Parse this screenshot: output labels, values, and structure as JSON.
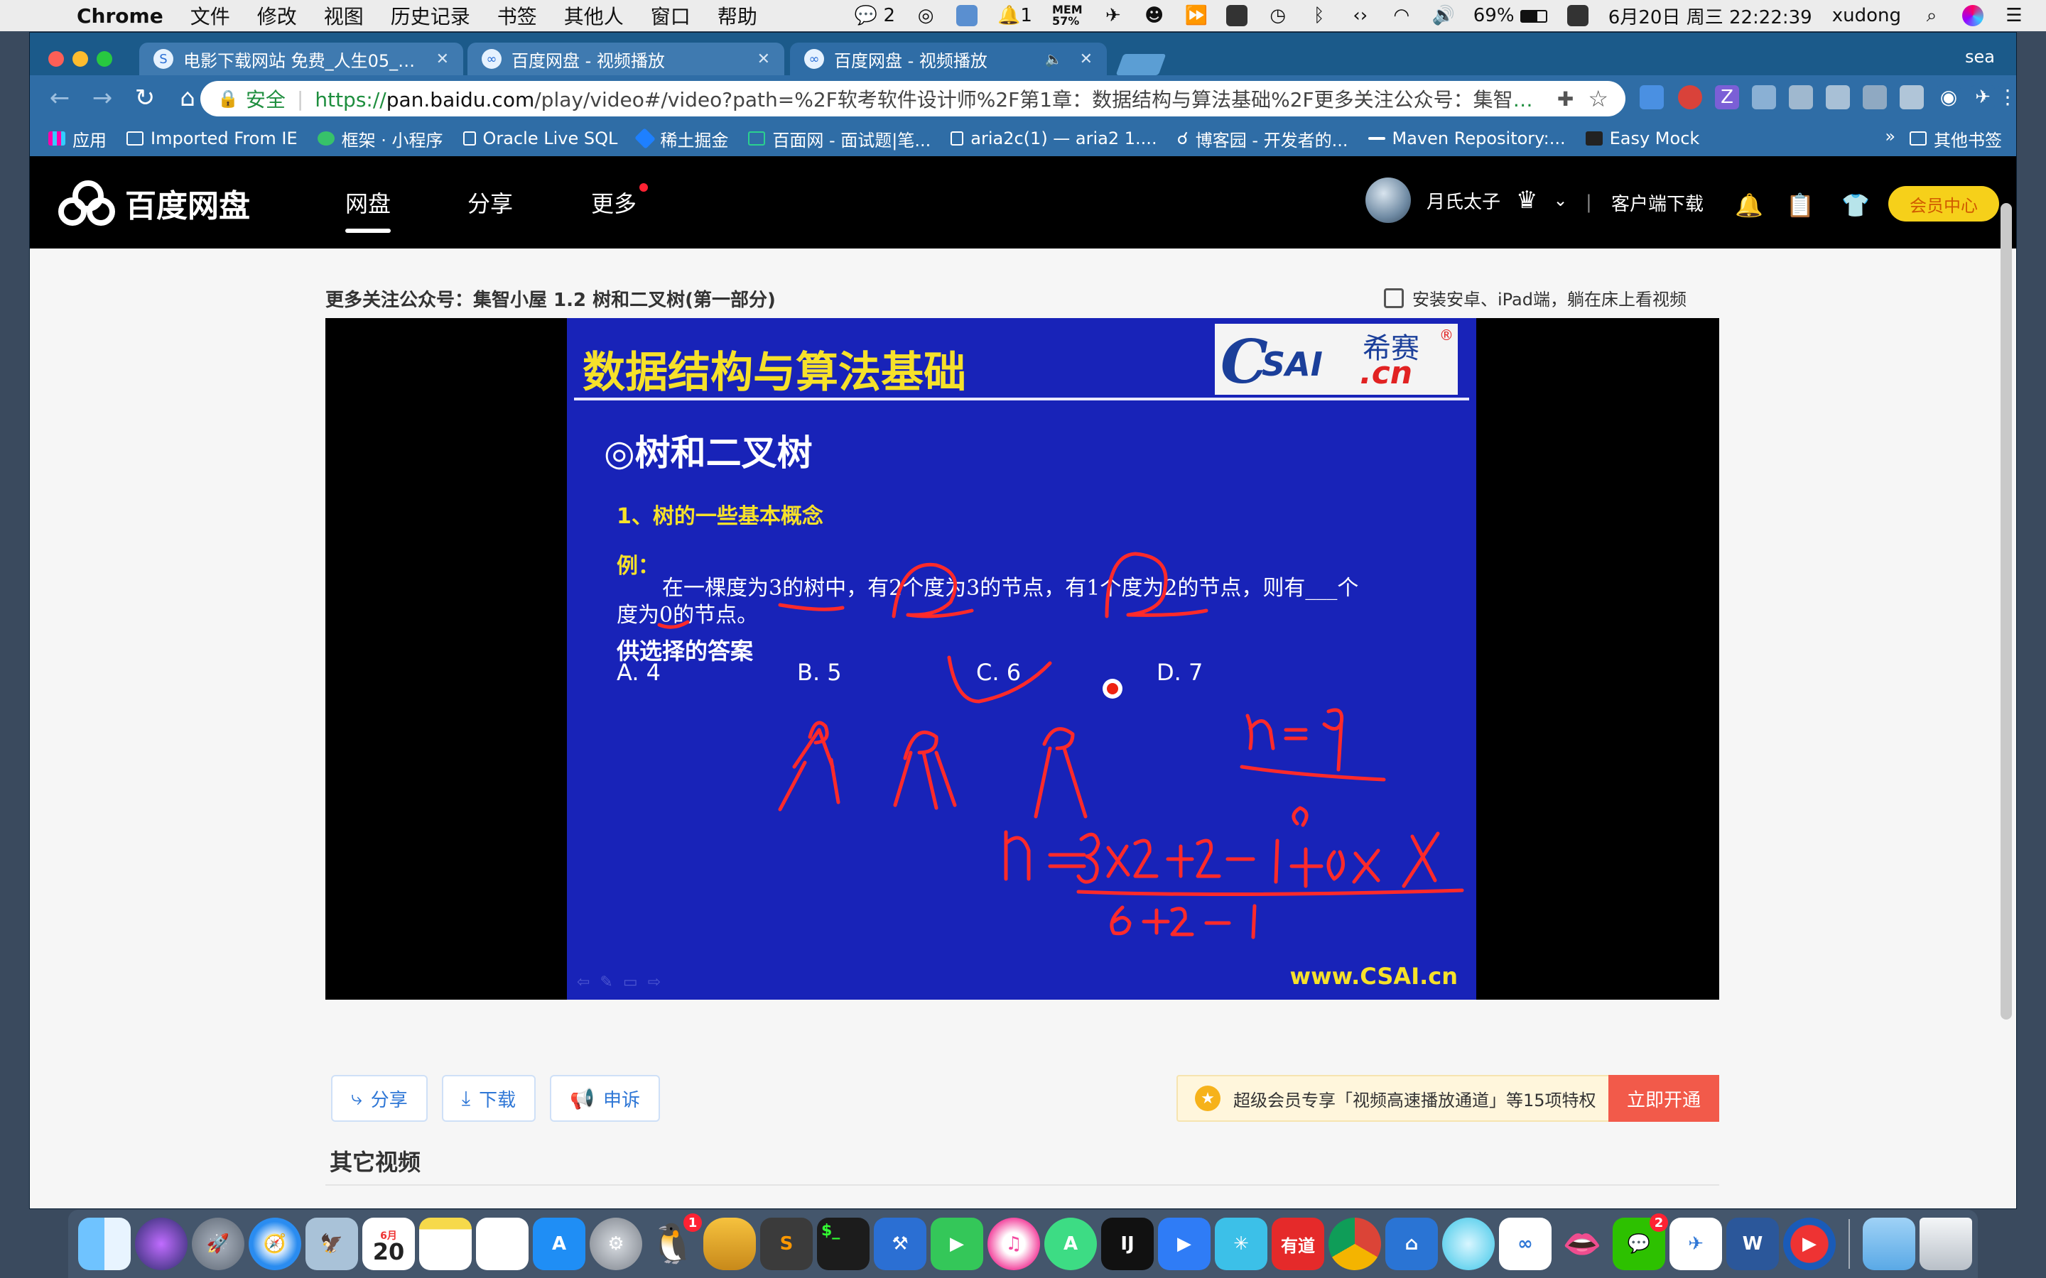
{
  "menubar": {
    "app": "Chrome",
    "menus": [
      "文件",
      "修改",
      "视图",
      "历史记录",
      "书签",
      "其他人",
      "窗口",
      "帮助"
    ],
    "wechat_count": "2",
    "notification_count": "1",
    "mem_label": "MEM",
    "mem_value": "57%",
    "battery": "69%",
    "datetime": "6月20日 周三 22:22:39",
    "user": "xudong"
  },
  "browser": {
    "profile": "sea",
    "tabs": [
      {
        "title": "电影下载网站 免费_人生05_电影",
        "active": false
      },
      {
        "title": "百度网盘 - 视频播放",
        "active": false
      },
      {
        "title": "百度网盘 - 视频播放",
        "active": true
      }
    ],
    "security_label": "安全",
    "url_scheme": "https://",
    "url_host": "pan.baidu.com",
    "url_path": "/play/video#/video?path=%2F软考软件设计师%2F第1章：数据结构与算法基础%2F更多关注公众号：集智小屋%20...",
    "bookmarks": [
      "应用",
      "Imported From IE",
      "框架 · 小程序",
      "Oracle Live SQL",
      "稀土掘金",
      "百面网 - 面试题|笔...",
      "aria2c(1) — aria2 1....",
      "博客园 - 开发者的...",
      "Maven Repository:...",
      "Easy Mock"
    ],
    "bookmarks_more": "»",
    "other_bookmarks": "其他书签"
  },
  "baidu": {
    "logo_text": "百度网盘",
    "nav": [
      "网盘",
      "分享",
      "更多"
    ],
    "username": "月氏太子",
    "client_download": "客户端下载",
    "vip_center": "会员中心",
    "divider": "|"
  },
  "page": {
    "video_title": "更多关注公众号：集智小屋 1.2 树和二叉树(第一部分)",
    "install_tip": "安装安卓、iPad端，躺在床上看视频",
    "actions": [
      {
        "label": "分享",
        "icon": "share-icon"
      },
      {
        "label": "下载",
        "icon": "download-icon"
      },
      {
        "label": "申诉",
        "icon": "megaphone-icon"
      }
    ],
    "promo_text": "超级会员专享「视频高速播放通道」等15项特权",
    "promo_button": "立即开通",
    "other_videos": "其它视频"
  },
  "slide": {
    "title": "数据结构与算法基础",
    "logo_c": "C",
    "logo_sai": "SAI",
    "logo_cn": ".cn",
    "logo_cn_chars": "希赛",
    "logo_reg": "®",
    "heading": "◎树和二叉树",
    "point1": "1、树的一些基本概念",
    "example_label": "例：",
    "question_line1": "在一棵度为3的树中，有2个度为3的节点，有1个度为2的节点，则有___个",
    "question_line2": "度为0的节点。",
    "options_label": "供选择的答案",
    "options": [
      "A. 4",
      "B. 5",
      "C. 6",
      "D. 7"
    ],
    "footer_url": "www.CSAI.cn",
    "controls": "⇦✎▭⇨",
    "answer_selected": "C"
  },
  "dock": {
    "qq_badge": "1",
    "wechat_badge": "2",
    "calendar_month": "6月",
    "calendar_day": "20",
    "youdao_label": "有道",
    "word_label": "W",
    "idea_label": "IJ"
  },
  "colors": {
    "tab_strip": "#1b5a8a",
    "toolbar": "#2f6da6",
    "slide_bg": "#1823b8",
    "slide_yellow": "#f6e12a",
    "ink_red": "#ff2a2a",
    "vip_yellow": "#f6d01a",
    "promo_red": "#f25a4a",
    "link_blue": "#2f77d6"
  }
}
